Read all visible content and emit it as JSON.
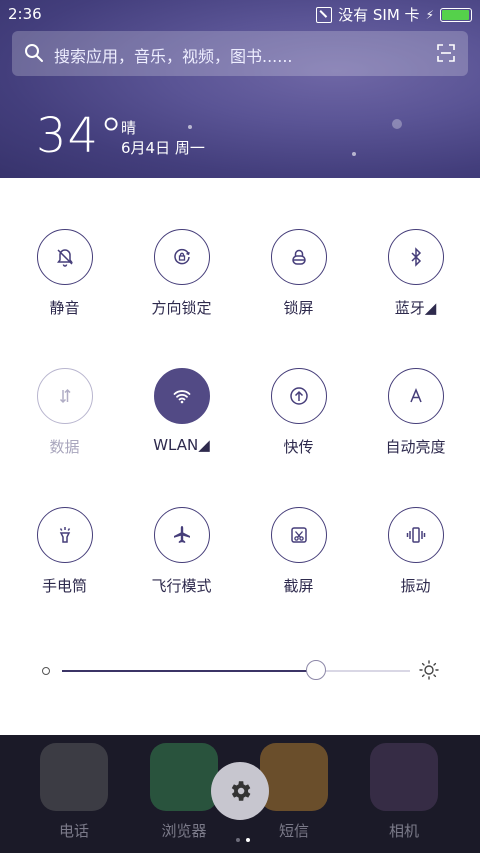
{
  "status_bar": {
    "time": "2:36",
    "sim": "没有 SIM 卡",
    "battery_level_pct": 95,
    "battery_color": "#55d14b"
  },
  "search": {
    "placeholder": "搜索应用，音乐，视频，图书......",
    "icon": "search-icon",
    "scan_icon": "scan-icon"
  },
  "weather": {
    "temperature": "34°",
    "condition": "晴",
    "date": "6月4日 周一"
  },
  "toggles": [
    {
      "label": "静音",
      "icon": "bell-off-icon",
      "state": "on"
    },
    {
      "label": "方向锁定",
      "icon": "rotation-lock-icon",
      "state": "on"
    },
    {
      "label": "锁屏",
      "icon": "lock-icon",
      "state": "on"
    },
    {
      "label": "蓝牙◢",
      "icon": "bluetooth-icon",
      "state": "on"
    },
    {
      "label": "数据",
      "icon": "mobile-data-icon",
      "state": "disabled"
    },
    {
      "label": "WLAN◢",
      "icon": "wifi-icon",
      "state": "active"
    },
    {
      "label": "快传",
      "icon": "quick-transfer-icon",
      "state": "on"
    },
    {
      "label": "自动亮度",
      "icon": "auto-brightness-icon",
      "state": "on"
    },
    {
      "label": "手电筒",
      "icon": "flashlight-icon",
      "state": "on"
    },
    {
      "label": "飞行模式",
      "icon": "airplane-icon",
      "state": "on"
    },
    {
      "label": "截屏",
      "icon": "screenshot-icon",
      "state": "on"
    },
    {
      "label": "振动",
      "icon": "vibrate-icon",
      "state": "on"
    }
  ],
  "brightness": {
    "level": 0.73
  },
  "dock": {
    "apps": [
      {
        "label": "电话",
        "color": "#6b6b6b"
      },
      {
        "label": "浏览器",
        "color": "#3fa35a"
      },
      {
        "label": "短信",
        "color": "#d9962f"
      },
      {
        "label": "相机",
        "color": "#5d466e"
      }
    ],
    "page_indicator": {
      "pages": 2,
      "current": 2
    }
  },
  "colors": {
    "accent": "#524a85",
    "header_bg": "#433e7c"
  }
}
